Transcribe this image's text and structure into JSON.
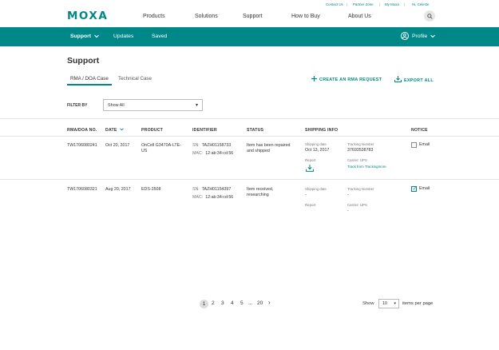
{
  "header": {
    "logo": "MOXA",
    "utility_links": [
      {
        "label": "Contact Us"
      },
      {
        "label": "Partner Zone"
      },
      {
        "label": "My Moxa"
      },
      {
        "label": "Hi, Celeste"
      }
    ],
    "nav": [
      {
        "label": "Products"
      },
      {
        "label": "Solutions"
      },
      {
        "label": "Support"
      },
      {
        "label": "How to Buy"
      },
      {
        "label": "About Us"
      }
    ],
    "search_icon": "search-icon"
  },
  "subnav": {
    "items": [
      {
        "label": "Support"
      },
      {
        "label": "Updates"
      },
      {
        "label": "Saved"
      }
    ],
    "profile_label": "Profile"
  },
  "page": {
    "title": "Support",
    "tabs": [
      {
        "label": "RMA / DOA Case",
        "active": true
      },
      {
        "label": "Technical Case",
        "active": false
      }
    ],
    "actions": {
      "create": "CREATE AN RMA REQUEST",
      "export": "EXPORT ALL"
    },
    "filter": {
      "label": "FILTER BY",
      "value": "Show All"
    }
  },
  "table": {
    "headers": {
      "rma": "RMA/DOA NO.",
      "date": "DATE",
      "product": "PRODUCT",
      "identifier": "IDENTIFIER",
      "status": "STATUS",
      "shipping": "SHIPPING INFO",
      "notice": "NOTICE"
    },
    "rows": [
      {
        "rma": "TW1706080241",
        "date": "Oct 20, 2017",
        "product_line1": "OnCell G3470A-LTE-",
        "product_line2": "US",
        "sn_label": "SN:",
        "sn": "TAZH01158733",
        "mac_label": "MAC:",
        "mac": "12:ab:34:cd:56",
        "status_line1": "Item has been repaired",
        "status_line2": "and shipped",
        "shipping_date_label": "Shipping date",
        "shipping_date": "Oct 13, 2017",
        "tracking_label": "Tracking Number",
        "tracking": "37693538783",
        "report_label": "Report",
        "carrier_label": "Carrier: UPS",
        "carrier_link": "Track from Trackingmore",
        "notice_label": "Email",
        "notice_checked": false
      },
      {
        "rma": "TW1706080321",
        "date": "Aug 20, 2017",
        "product_line1": "EDS-3508",
        "product_line2": "",
        "sn_label": "SN:",
        "sn": "TAZH01154397",
        "mac_label": "MAC:",
        "mac": "12:ab:34:cd:56",
        "status_line1": "Item received,",
        "status_line2": "researching",
        "shipping_date_label": "Shipping date",
        "shipping_date": "-",
        "tracking_label": "Tracking Number",
        "tracking": "-",
        "report_label": "Report",
        "carrier_label": "Carrier: UPS",
        "carrier_value": "-",
        "notice_label": "Email",
        "notice_checked": true
      }
    ]
  },
  "pagination": {
    "pages": [
      "1",
      "2",
      "3",
      "4",
      "5",
      "...",
      "20"
    ],
    "current": "1",
    "next": "›",
    "show_label": "Show",
    "per_page_value": "10",
    "per_page_suffix": "items per page"
  },
  "colors": {
    "accent": "#008787",
    "divider": "#e3e3e3"
  }
}
